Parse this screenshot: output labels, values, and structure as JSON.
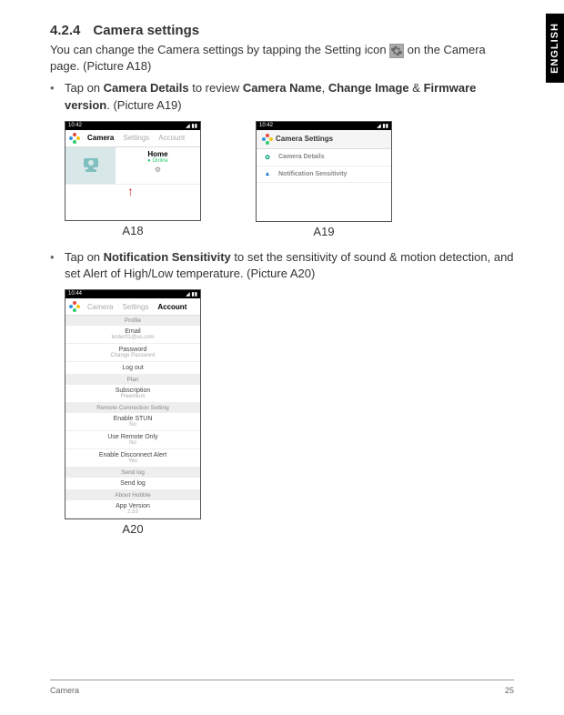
{
  "language_tab": "ENGLISH",
  "section": {
    "number": "4.2.4",
    "title": "Camera settings",
    "intro_before": "You can change the Camera settings by tapping the Setting icon ",
    "intro_after": " on the Camera page. (Picture A18)"
  },
  "bullet1": {
    "pre": "Tap on ",
    "b1": "Camera Details",
    "mid1": " to review ",
    "b2": "Camera Name",
    "mid2": ", ",
    "b3": "Change Image",
    "mid3": " & ",
    "b4": "Firmware version",
    "post": ". (Picture A19)"
  },
  "bullet2": {
    "pre": "Tap on ",
    "b1": "Notification Sensitivity",
    "post": " to set the sensitivity of sound & motion detection, and set Alert of High/Low temperature. (Picture A20)"
  },
  "a18": {
    "time": "10:42",
    "signal": "◢ ▮▮",
    "tabs": {
      "camera": "Camera",
      "settings": "Settings",
      "account": "Account"
    },
    "cam_name": "Home",
    "cam_status": "Online",
    "caption": "A18"
  },
  "a19": {
    "time": "10:42",
    "signal": "◢ ▮▮",
    "header": "Camera Settings",
    "row1": "Camera Details",
    "row2": "Notification Sensitivity",
    "caption": "A19"
  },
  "a20": {
    "time": "10:44",
    "signal": "◢ ▮▮",
    "tabs": {
      "camera": "Camera",
      "settings": "Settings",
      "account": "Account"
    },
    "sections": {
      "profile": "Profile",
      "plan": "Plan",
      "remote": "Remote Connection Setting",
      "sendlog": "Send log",
      "about": "About Hubble"
    },
    "items": {
      "email_l": "Email",
      "email_v": "tester01@us.com",
      "pass_l": "Password",
      "pass_v": "Change Password",
      "logout": "Log out",
      "sub_l": "Subscription",
      "sub_v": "Freemium",
      "stun_l": "Enable STUN",
      "stun_v": "No",
      "remote_l": "Use Remote Only",
      "remote_v": "No",
      "disc_l": "Enable Disconnect Alert",
      "disc_v": "Yes",
      "sendlog": "Send log",
      "ver_l": "App Version",
      "ver_v": "2.53"
    },
    "caption": "A20"
  },
  "footer": {
    "left": "Camera",
    "right": "25"
  }
}
